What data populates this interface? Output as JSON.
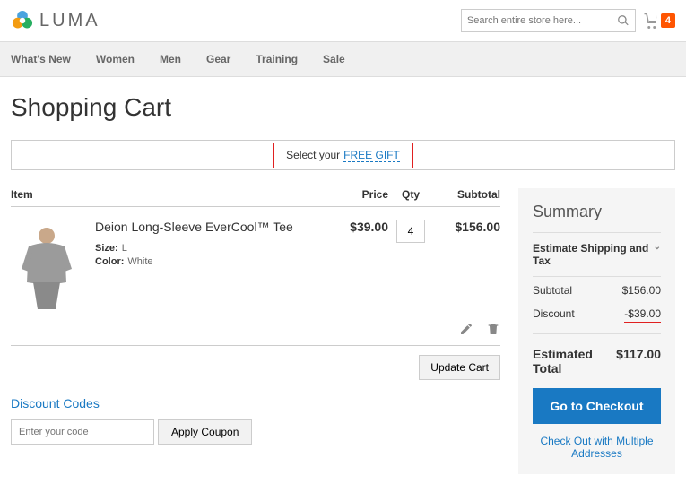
{
  "header": {
    "logo_text": "LUMA",
    "search_placeholder": "Search entire store here...",
    "cart_count": "4"
  },
  "nav": {
    "items": [
      "What's New",
      "Women",
      "Men",
      "Gear",
      "Training",
      "Sale"
    ]
  },
  "page_title": "Shopping Cart",
  "free_gift": {
    "prefix": "Select your",
    "link": "FREE GIFT"
  },
  "columns": {
    "item": "Item",
    "price": "Price",
    "qty": "Qty",
    "subtotal": "Subtotal"
  },
  "product": {
    "name": "Deion Long-Sleeve EverCool™ Tee",
    "size_label": "Size:",
    "size_value": "L",
    "color_label": "Color:",
    "color_value": "White",
    "price": "$39.00",
    "qty": "4",
    "subtotal": "$156.00"
  },
  "buttons": {
    "update_cart": "Update Cart",
    "apply_coupon": "Apply Coupon",
    "checkout": "Go to Checkout"
  },
  "discount": {
    "title": "Discount Codes",
    "placeholder": "Enter your code"
  },
  "summary": {
    "title": "Summary",
    "estimate": "Estimate Shipping and Tax",
    "subtotal_label": "Subtotal",
    "subtotal_value": "$156.00",
    "discount_label": "Discount",
    "discount_value": "-$39.00",
    "total_label": "Estimated Total",
    "total_value": "$117.00",
    "multi": "Check Out with Multiple Addresses"
  }
}
